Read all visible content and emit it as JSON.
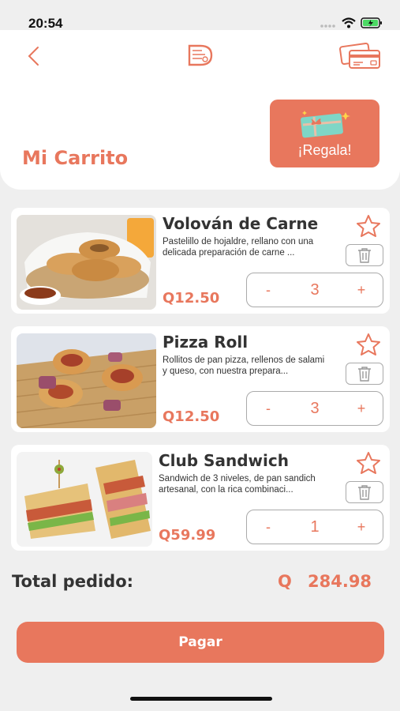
{
  "status_bar": {
    "time": "20:54"
  },
  "colors": {
    "accent": "#e8775d",
    "card": "#ffffff",
    "background": "#efefef",
    "text": "#333333"
  },
  "icons": {
    "back": "chevron-left-icon",
    "logo": "restaurant-logo-icon",
    "cards": "credit-cards-icon",
    "gift": "gift-card-icon",
    "favorite": "star-icon",
    "delete": "trash-icon"
  },
  "header": {
    "title": "Mi Carrito",
    "gift_label": "¡Regala!"
  },
  "cart": {
    "items": [
      {
        "name": "Volován de Carne",
        "description": "Pastelillo de hojaldre, rellano con una delicada preparación de carne ...",
        "price": "Q12.50",
        "quantity": "3",
        "minus": "-",
        "plus": "+"
      },
      {
        "name": "Pizza Roll",
        "description": "Rollitos de pan pizza, rellenos de salami y queso, con nuestra prepara...",
        "price": "Q12.50",
        "quantity": "3",
        "minus": "-",
        "plus": "+"
      },
      {
        "name": "Club Sandwich",
        "description": "Sandwich de 3 niveles, de pan sandich artesanal, con la rica combinaci...",
        "price": "Q59.99",
        "quantity": "1",
        "minus": "-",
        "plus": "+"
      }
    ]
  },
  "summary": {
    "total_label": "Total pedido:",
    "currency": "Q",
    "total_value": "284.98"
  },
  "actions": {
    "pay_label": "Pagar"
  }
}
